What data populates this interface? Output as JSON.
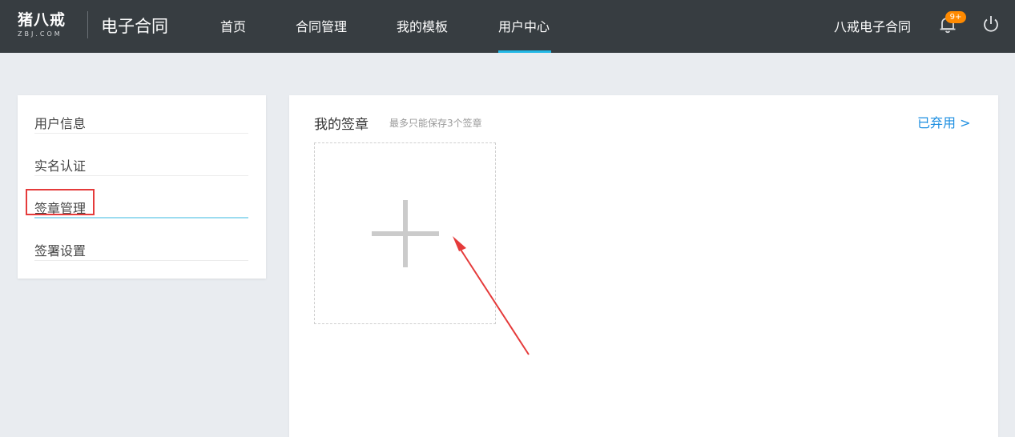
{
  "header": {
    "logo_text": "猪八戒",
    "logo_sub": "ZBJ.COM",
    "product_name": "电子合同",
    "nav": [
      {
        "label": "首页"
      },
      {
        "label": "合同管理"
      },
      {
        "label": "我的模板"
      },
      {
        "label": "用户中心",
        "active": true
      }
    ],
    "company_name": "八戒电子合同",
    "notification_badge": "9+",
    "icons": [
      "bell-icon",
      "power-icon"
    ],
    "accent_color": "#22b8e6"
  },
  "sidebar": {
    "items": [
      {
        "label": "用户信息"
      },
      {
        "label": "实名认证"
      },
      {
        "label": "签章管理",
        "active": true
      },
      {
        "label": "签署设置"
      }
    ]
  },
  "main": {
    "title": "我的签章",
    "hint": "最多只能保存3个签章",
    "discarded_link": "已弃用 >",
    "add_tile_icon": "plus-icon"
  }
}
